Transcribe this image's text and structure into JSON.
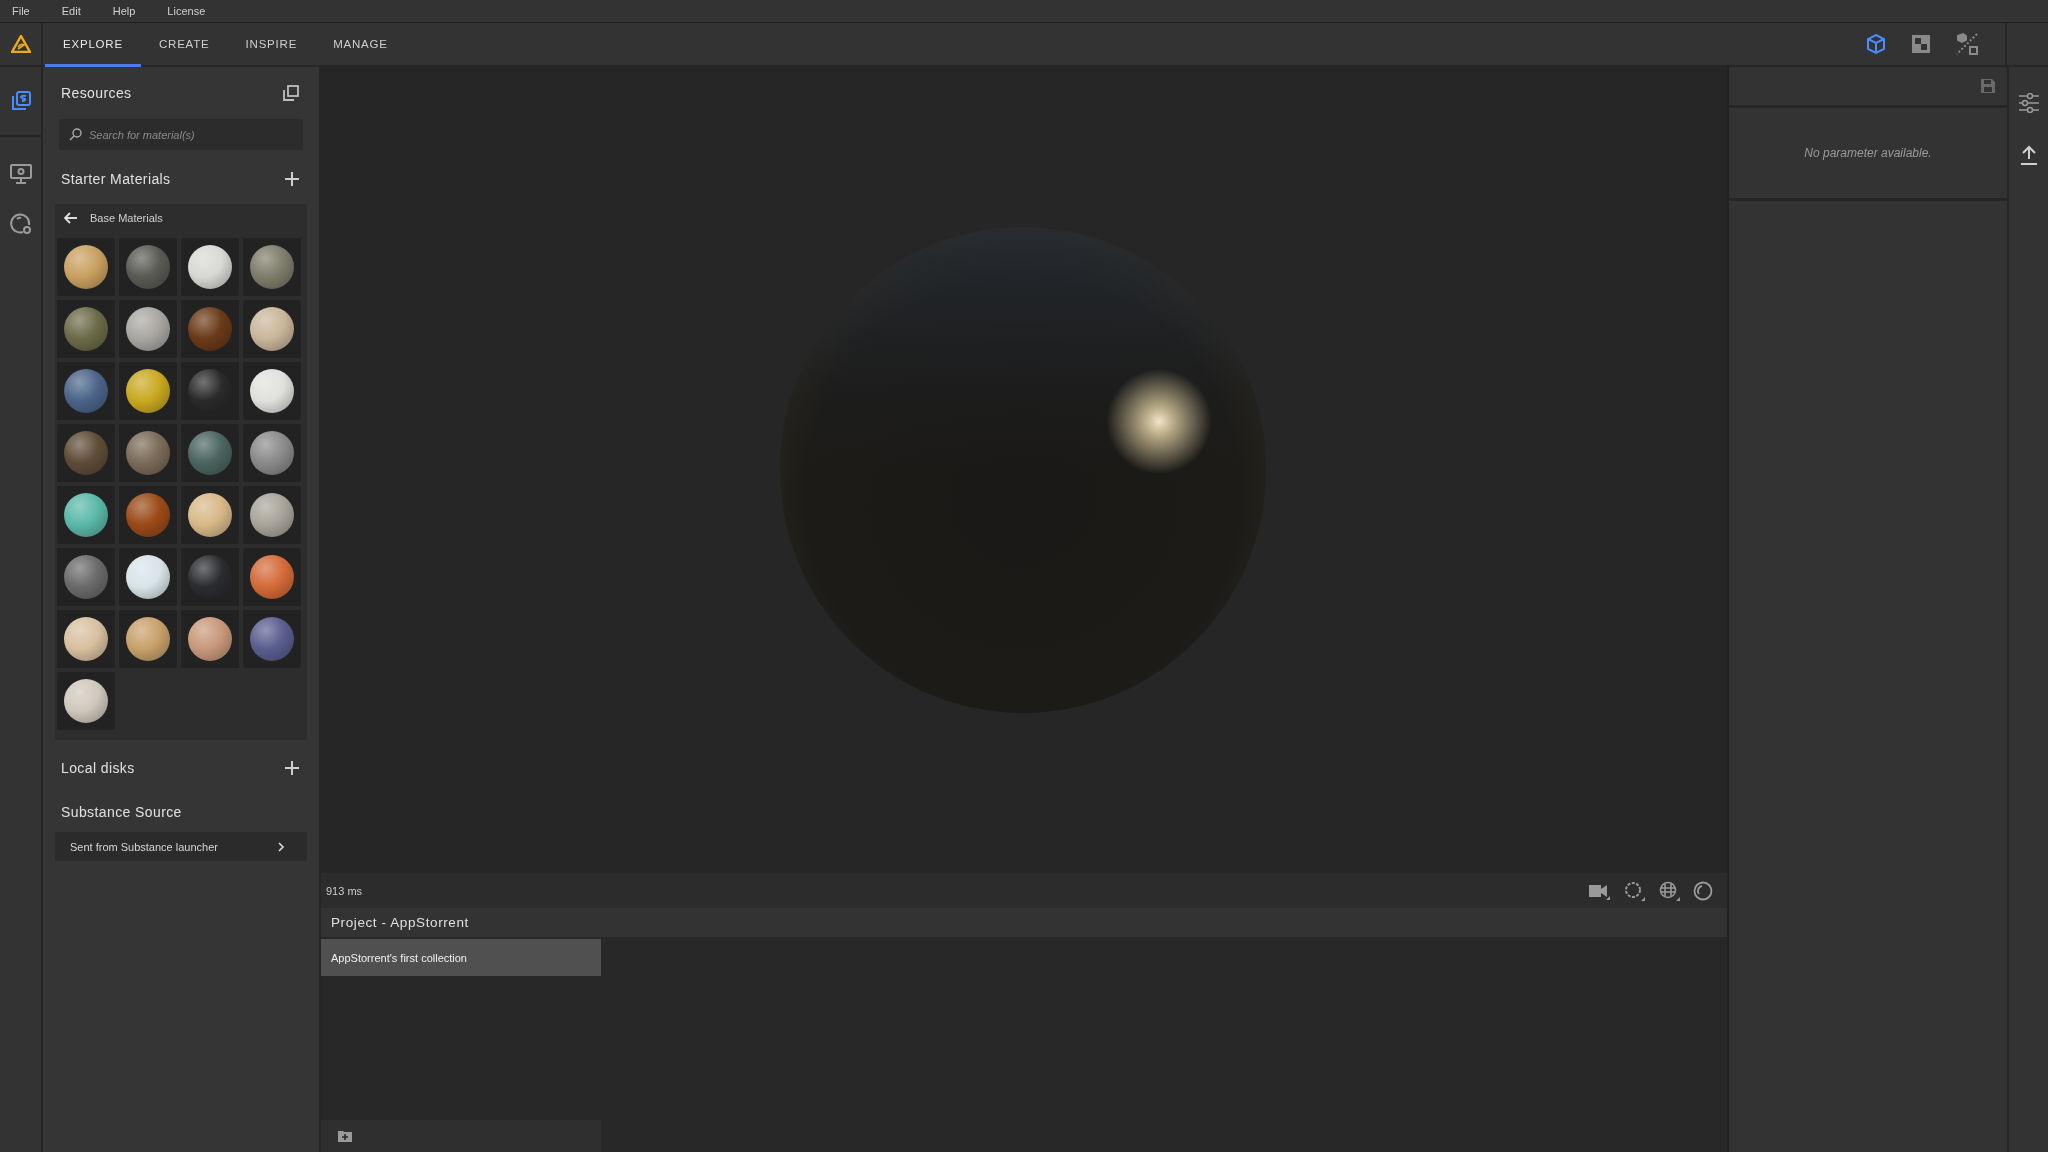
{
  "menu": [
    "File",
    "Edit",
    "Help",
    "License"
  ],
  "tabs": [
    {
      "label": "EXPLORE",
      "selected": true
    },
    {
      "label": "CREATE",
      "selected": false
    },
    {
      "label": "INSPIRE",
      "selected": false
    },
    {
      "label": "MANAGE",
      "selected": false
    }
  ],
  "view_modes": [
    {
      "kind": "perspective",
      "selected": true
    },
    {
      "kind": "flat",
      "selected": false
    },
    {
      "kind": "split",
      "selected": false
    }
  ],
  "left_rail": [
    {
      "kind": "library",
      "selected": true
    },
    {
      "kind": "display",
      "selected": false
    },
    {
      "kind": "environment",
      "selected": false
    }
  ],
  "resources": {
    "title": "Resources",
    "search": {
      "placeholder": "Search for material(s)"
    }
  },
  "starter_materials": {
    "title": "Starter Materials",
    "folder": "Base Materials",
    "materials": [
      {
        "color": "#c9a060"
      },
      {
        "color": "#5a5a55"
      },
      {
        "color": "#d8d8d4"
      },
      {
        "color": "#7e7c6a"
      },
      {
        "color": "#6b6a48"
      },
      {
        "color": "#a9a6a2"
      },
      {
        "color": "#6a3a18"
      },
      {
        "color": "#c9b69a"
      },
      {
        "color": "#4a6488"
      },
      {
        "color": "#c9a820"
      },
      {
        "color": "#2a2a2a"
      },
      {
        "color": "#e0e0dc"
      },
      {
        "color": "#5e4c38"
      },
      {
        "color": "#7a6a58"
      },
      {
        "color": "#4a6460"
      },
      {
        "color": "#8a8a8a"
      },
      {
        "color": "#5ab8a8"
      },
      {
        "color": "#9a4a18"
      },
      {
        "color": "#d8b888"
      },
      {
        "color": "#a8a49a"
      },
      {
        "color": "#6a6a6a"
      },
      {
        "color": "#d8e4e8"
      },
      {
        "color": "#2a2c30"
      },
      {
        "color": "#d46a38"
      },
      {
        "color": "#d8c0a0"
      },
      {
        "color": "#c8a06a"
      },
      {
        "color": "#c8987a"
      },
      {
        "color": "#5a5e90"
      },
      {
        "color": "#cfc8bc"
      }
    ]
  },
  "local_disks": {
    "title": "Local disks"
  },
  "substance_source": {
    "title": "Substance Source",
    "items": [
      "Sent from Substance launcher"
    ]
  },
  "viewport": {
    "render_time": "913 ms"
  },
  "project": {
    "title": "Project - AppStorrent",
    "collections": [
      {
        "label": "AppStorrent's first collection",
        "selected": true
      }
    ]
  },
  "parameters": {
    "message": "No parameter available."
  }
}
